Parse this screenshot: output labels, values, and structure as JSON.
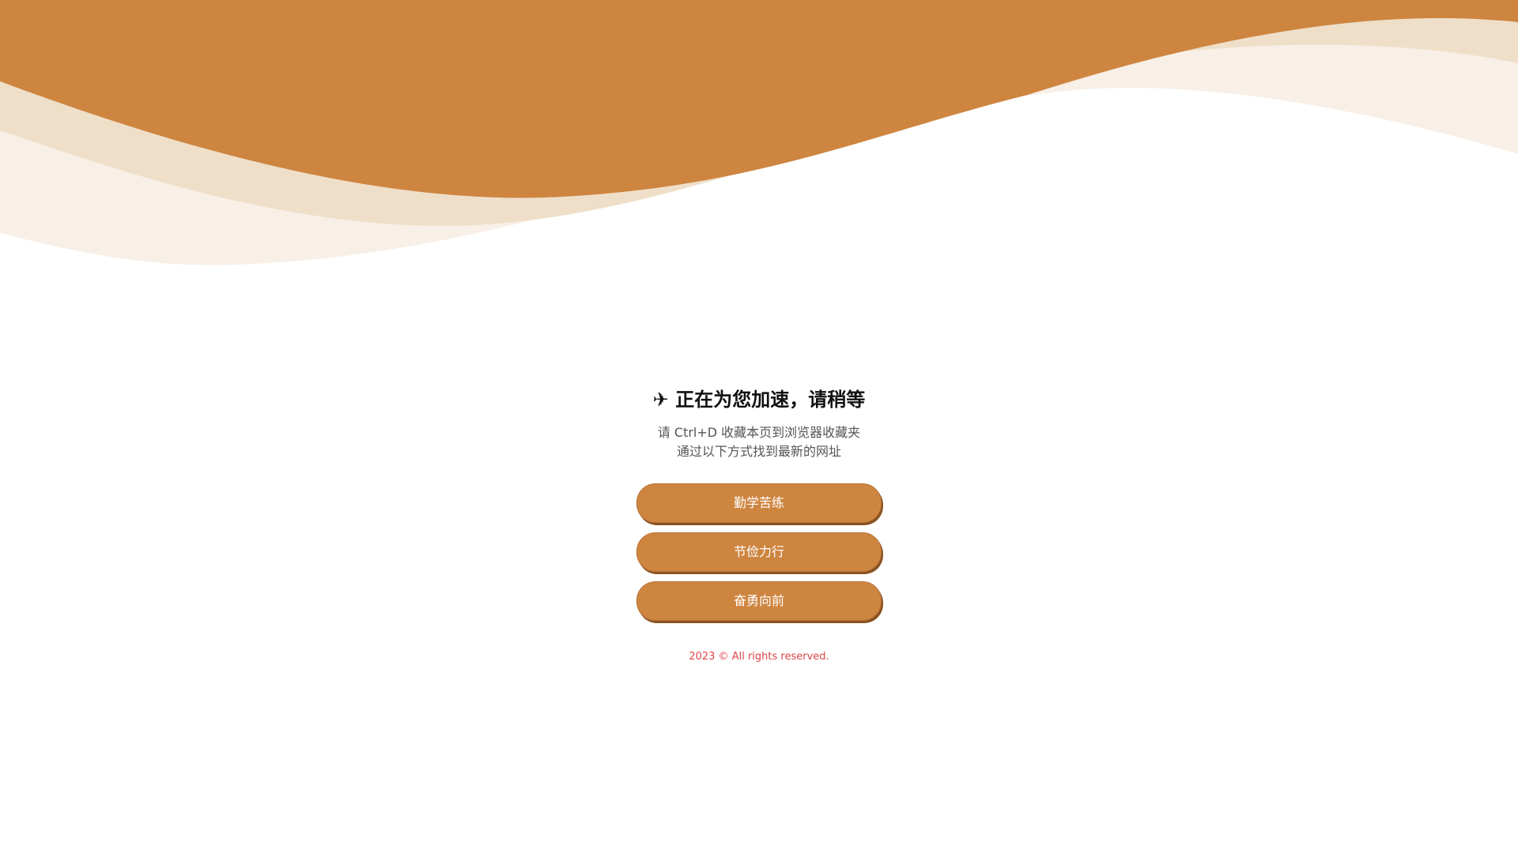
{
  "header": {
    "colors": {
      "primary": "#ce8540",
      "layer2": "#efdfc9",
      "layer3": "#f7ece2"
    }
  },
  "main": {
    "icon": "airplane-icon",
    "title_icon_glyph": "✈",
    "title": "正在为您加速，请稍等",
    "line1": "请 Ctrl+D 收藏本页到浏览器收藏夹",
    "line2": "通过以下方式找到最新的网址"
  },
  "buttons": [
    {
      "label": "勤学苦练"
    },
    {
      "label": "节俭力行"
    },
    {
      "label": "奋勇向前"
    }
  ],
  "footer": {
    "text": "2023 © All rights reserved."
  }
}
